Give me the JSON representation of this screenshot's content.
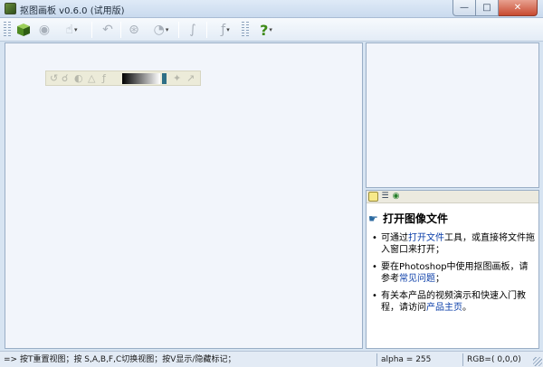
{
  "window": {
    "title": "抠图画板 v0.6.0 (试用版)",
    "min_glyph": "—",
    "max_glyph": "□",
    "close_glyph": "✕"
  },
  "toolbar": {
    "items": [
      {
        "name": "cube-icon",
        "glyph": ""
      },
      {
        "name": "eye-icon",
        "glyph": "◉"
      },
      {
        "name": "hand-icon",
        "glyph": "☝"
      },
      {
        "name": "undo-icon",
        "glyph": "↶"
      },
      {
        "name": "stamp-icon",
        "glyph": "⊛"
      },
      {
        "name": "pie-icon",
        "glyph": "◔"
      },
      {
        "name": "curve-icon",
        "glyph": "∫"
      },
      {
        "name": "pen-icon",
        "glyph": "ƒ"
      },
      {
        "name": "help-icon",
        "glyph": "?"
      }
    ],
    "dropdown_glyph": "▾"
  },
  "canvas_floatbar": {
    "glyphs": [
      "↺",
      "☌",
      "◐",
      "△",
      "ƒ",
      "✦",
      "↗"
    ]
  },
  "help_panel": {
    "toolbar_glyphs": {
      "list": "☰",
      "eye": "◉"
    },
    "title_icon": "☛",
    "title": "打开图像文件",
    "items": [
      {
        "pre": "可通过",
        "link": "打开文件",
        "post": "工具，或直接将文件拖入窗口来打开；"
      },
      {
        "pre": "要在Photoshop中使用抠图画板，请参考",
        "link": "常见问题",
        "post": "；"
      },
      {
        "pre": "有关本产品的视频演示和快速入门教程，请访问",
        "link": "产品主页",
        "post": "。"
      }
    ]
  },
  "statusbar": {
    "hint": "=> 按T重置视图；按 S,A,B,F,C切换视图；按V显示/隐藏标记；",
    "alpha": "alpha = 255",
    "rgb": "RGB=( 0,0,0)"
  }
}
